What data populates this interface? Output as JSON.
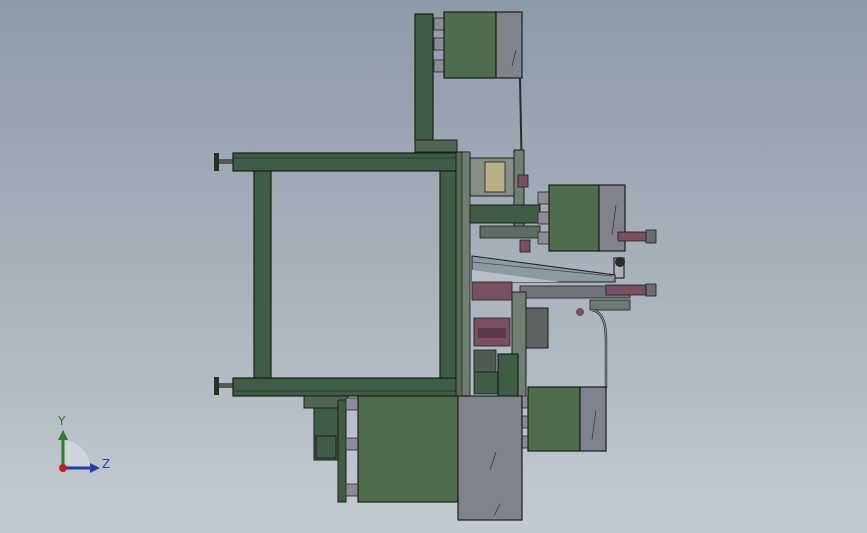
{
  "viewport": {
    "background_top": "#8d9aa8",
    "background_bottom": "#c3cad1"
  },
  "colors": {
    "frame_green": "#3f5c44",
    "motor_green": "#4f6c4c",
    "steel": "#80838b",
    "purple": "#7a4f62",
    "outline": "#1b1f1b"
  },
  "triad": {
    "y_label": "Y",
    "z_label": "Z",
    "y_color": "#2f7a2f",
    "z_color": "#1f3fb0",
    "origin_color": "#c02020"
  }
}
